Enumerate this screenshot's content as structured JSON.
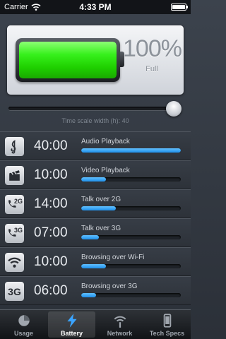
{
  "status_bar": {
    "carrier": "Carrier",
    "time": "4:33 PM"
  },
  "battery": {
    "level_percent": 100,
    "percent_text": "100%",
    "state": "Full",
    "fill_color": "#2ee014"
  },
  "time_scale": {
    "label": "Time scale width (h): 40",
    "position_fraction": 1.0
  },
  "activities": [
    {
      "icon": "music-clef-icon",
      "time": "40:00",
      "label": "Audio Playback",
      "fraction": 1.0
    },
    {
      "icon": "video-clapper-icon",
      "time": "10:00",
      "label": "Video Playback",
      "fraction": 0.25
    },
    {
      "icon": "phone-2g-icon",
      "icon_text": "2G",
      "time": "14:00",
      "label": "Talk over 2G",
      "fraction": 0.35
    },
    {
      "icon": "phone-3g-icon",
      "icon_text": "3G",
      "time": "07:00",
      "label": "Talk over 3G",
      "fraction": 0.18
    },
    {
      "icon": "wifi-icon",
      "time": "10:00",
      "label": "Browsing over Wi-Fi",
      "fraction": 0.25
    },
    {
      "icon": "3g-badge-icon",
      "icon_text": "3G",
      "time": "06:00",
      "label": "Browsing over 3G",
      "fraction": 0.15
    }
  ],
  "tabs": [
    {
      "label": "Usage",
      "icon": "pie-chart-icon",
      "active": false
    },
    {
      "label": "Battery",
      "icon": "lightning-icon",
      "active": true
    },
    {
      "label": "Network",
      "icon": "network-signal-icon",
      "active": false
    },
    {
      "label": "Tech Specs",
      "icon": "phone-icon",
      "active": false
    }
  ],
  "colors": {
    "accent_blue": "#2a9cf0",
    "battery_green": "#2ee014"
  }
}
